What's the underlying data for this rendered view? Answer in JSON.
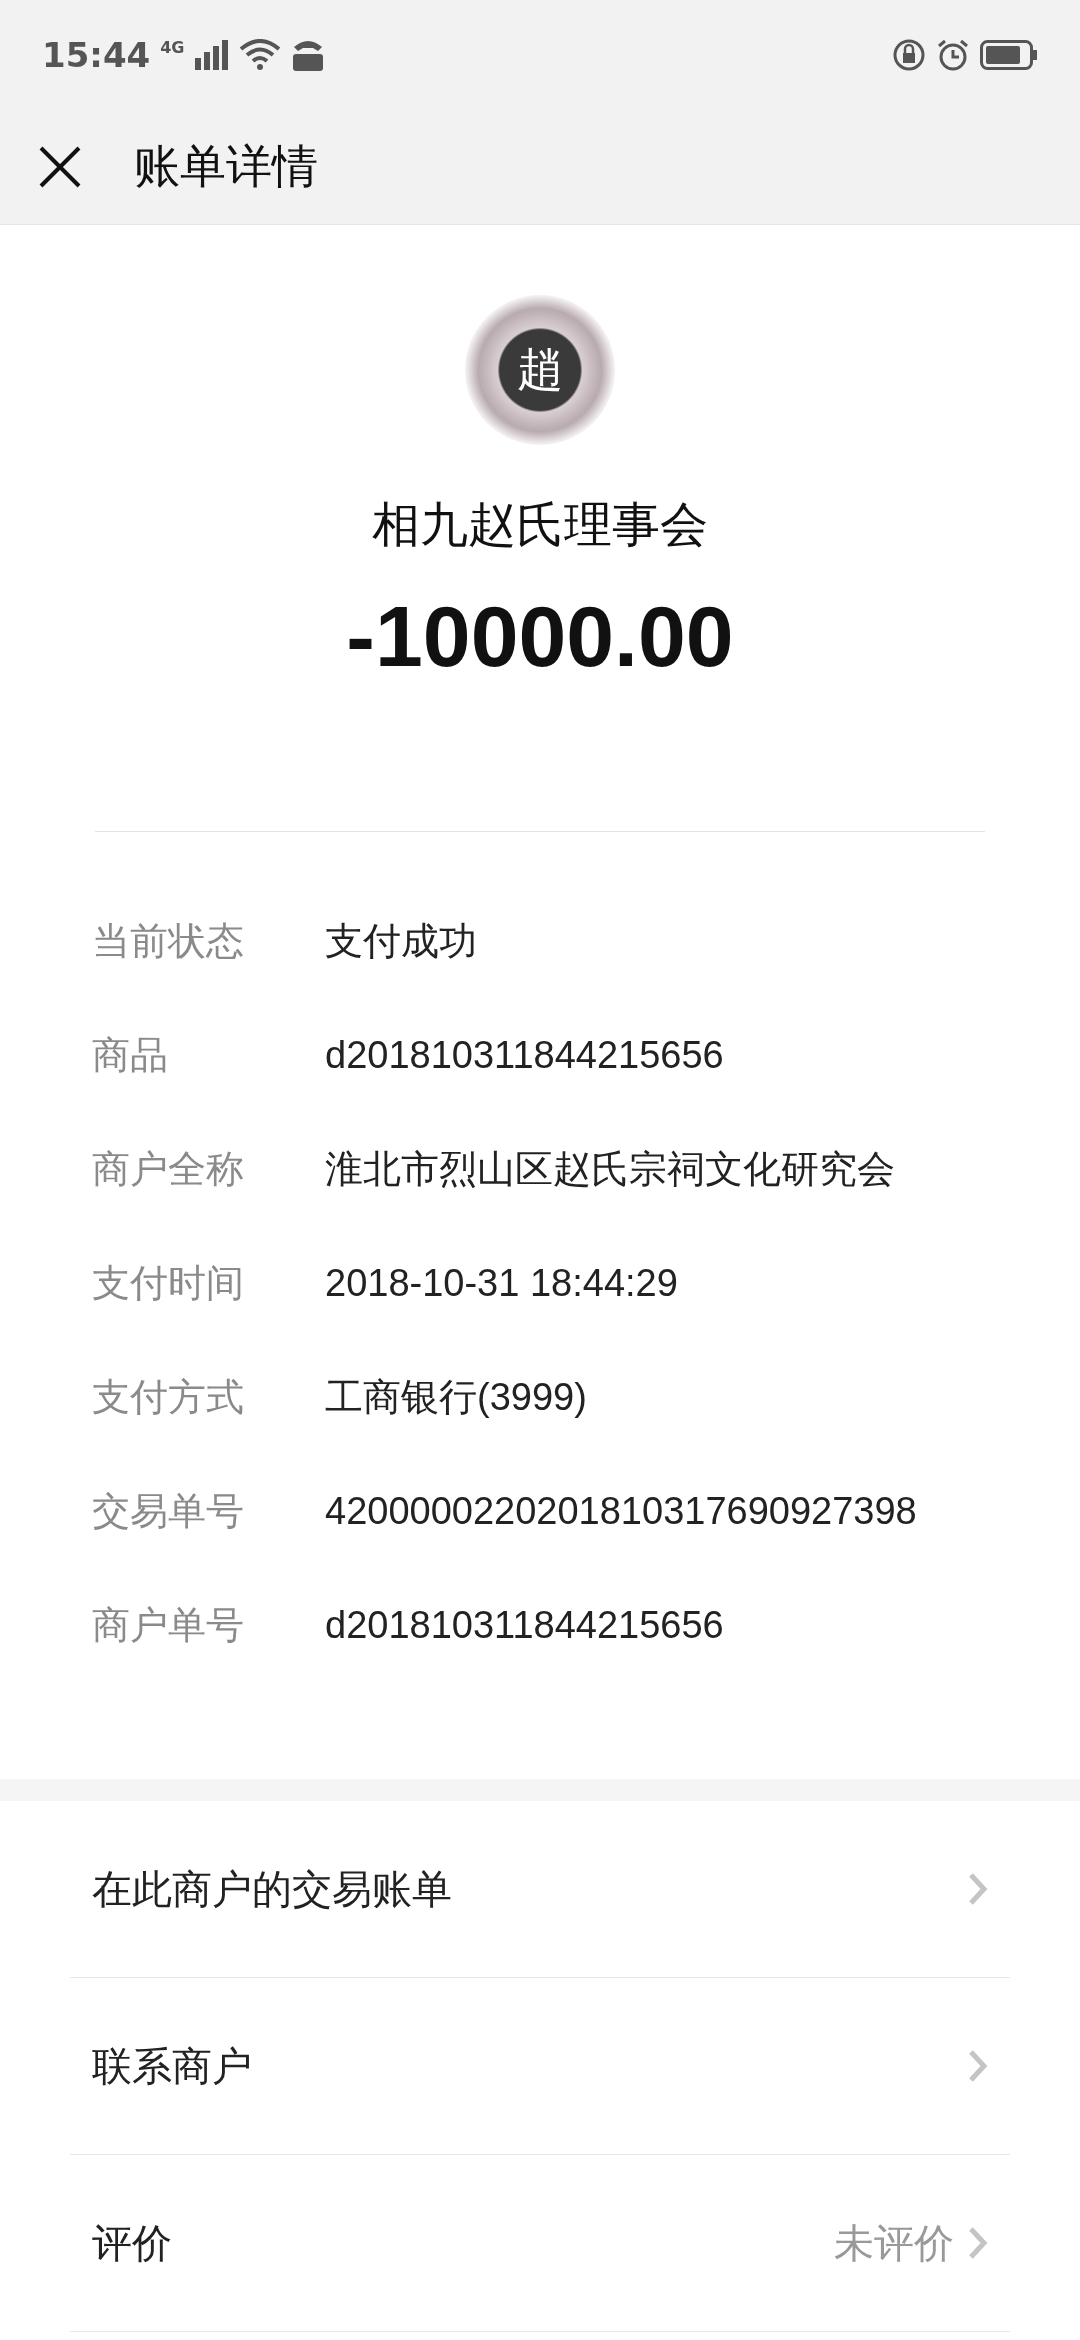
{
  "status_bar": {
    "time": "15:44",
    "network": "4G"
  },
  "header": {
    "title": "账单详情"
  },
  "merchant": {
    "logo_text": "趙",
    "name": "相九赵氏理事会",
    "amount": "-10000.00"
  },
  "details": [
    {
      "label": "当前状态",
      "value": "支付成功"
    },
    {
      "label": "商品",
      "value": "d201810311844215656"
    },
    {
      "label": "商户全称",
      "value": "淮北市烈山区赵氏宗祠文化研究会"
    },
    {
      "label": "支付时间",
      "value": "2018-10-31 18:44:29"
    },
    {
      "label": "支付方式",
      "value": "工商银行(3999)"
    },
    {
      "label": "交易单号",
      "value": "4200000220201810317690927398"
    },
    {
      "label": "商户单号",
      "value": "d201810311844215656"
    }
  ],
  "links": [
    {
      "label": "在此商户的交易账单"
    },
    {
      "label": "联系商户"
    },
    {
      "label": "评价",
      "value": "未评价"
    }
  ]
}
